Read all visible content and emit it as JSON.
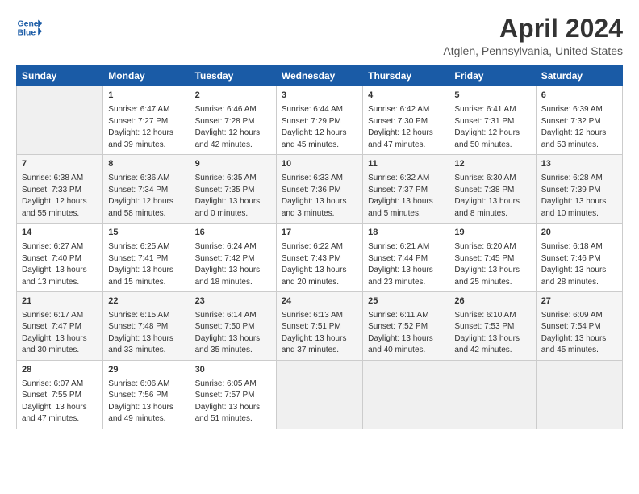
{
  "header": {
    "logo_line1": "General",
    "logo_line2": "Blue",
    "title": "April 2024",
    "subtitle": "Atglen, Pennsylvania, United States"
  },
  "columns": [
    "Sunday",
    "Monday",
    "Tuesday",
    "Wednesday",
    "Thursday",
    "Friday",
    "Saturday"
  ],
  "weeks": [
    [
      {
        "day": "",
        "content": ""
      },
      {
        "day": "1",
        "content": "Sunrise: 6:47 AM\nSunset: 7:27 PM\nDaylight: 12 hours\nand 39 minutes."
      },
      {
        "day": "2",
        "content": "Sunrise: 6:46 AM\nSunset: 7:28 PM\nDaylight: 12 hours\nand 42 minutes."
      },
      {
        "day": "3",
        "content": "Sunrise: 6:44 AM\nSunset: 7:29 PM\nDaylight: 12 hours\nand 45 minutes."
      },
      {
        "day": "4",
        "content": "Sunrise: 6:42 AM\nSunset: 7:30 PM\nDaylight: 12 hours\nand 47 minutes."
      },
      {
        "day": "5",
        "content": "Sunrise: 6:41 AM\nSunset: 7:31 PM\nDaylight: 12 hours\nand 50 minutes."
      },
      {
        "day": "6",
        "content": "Sunrise: 6:39 AM\nSunset: 7:32 PM\nDaylight: 12 hours\nand 53 minutes."
      }
    ],
    [
      {
        "day": "7",
        "content": "Sunrise: 6:38 AM\nSunset: 7:33 PM\nDaylight: 12 hours\nand 55 minutes."
      },
      {
        "day": "8",
        "content": "Sunrise: 6:36 AM\nSunset: 7:34 PM\nDaylight: 12 hours\nand 58 minutes."
      },
      {
        "day": "9",
        "content": "Sunrise: 6:35 AM\nSunset: 7:35 PM\nDaylight: 13 hours\nand 0 minutes."
      },
      {
        "day": "10",
        "content": "Sunrise: 6:33 AM\nSunset: 7:36 PM\nDaylight: 13 hours\nand 3 minutes."
      },
      {
        "day": "11",
        "content": "Sunrise: 6:32 AM\nSunset: 7:37 PM\nDaylight: 13 hours\nand 5 minutes."
      },
      {
        "day": "12",
        "content": "Sunrise: 6:30 AM\nSunset: 7:38 PM\nDaylight: 13 hours\nand 8 minutes."
      },
      {
        "day": "13",
        "content": "Sunrise: 6:28 AM\nSunset: 7:39 PM\nDaylight: 13 hours\nand 10 minutes."
      }
    ],
    [
      {
        "day": "14",
        "content": "Sunrise: 6:27 AM\nSunset: 7:40 PM\nDaylight: 13 hours\nand 13 minutes."
      },
      {
        "day": "15",
        "content": "Sunrise: 6:25 AM\nSunset: 7:41 PM\nDaylight: 13 hours\nand 15 minutes."
      },
      {
        "day": "16",
        "content": "Sunrise: 6:24 AM\nSunset: 7:42 PM\nDaylight: 13 hours\nand 18 minutes."
      },
      {
        "day": "17",
        "content": "Sunrise: 6:22 AM\nSunset: 7:43 PM\nDaylight: 13 hours\nand 20 minutes."
      },
      {
        "day": "18",
        "content": "Sunrise: 6:21 AM\nSunset: 7:44 PM\nDaylight: 13 hours\nand 23 minutes."
      },
      {
        "day": "19",
        "content": "Sunrise: 6:20 AM\nSunset: 7:45 PM\nDaylight: 13 hours\nand 25 minutes."
      },
      {
        "day": "20",
        "content": "Sunrise: 6:18 AM\nSunset: 7:46 PM\nDaylight: 13 hours\nand 28 minutes."
      }
    ],
    [
      {
        "day": "21",
        "content": "Sunrise: 6:17 AM\nSunset: 7:47 PM\nDaylight: 13 hours\nand 30 minutes."
      },
      {
        "day": "22",
        "content": "Sunrise: 6:15 AM\nSunset: 7:48 PM\nDaylight: 13 hours\nand 33 minutes."
      },
      {
        "day": "23",
        "content": "Sunrise: 6:14 AM\nSunset: 7:50 PM\nDaylight: 13 hours\nand 35 minutes."
      },
      {
        "day": "24",
        "content": "Sunrise: 6:13 AM\nSunset: 7:51 PM\nDaylight: 13 hours\nand 37 minutes."
      },
      {
        "day": "25",
        "content": "Sunrise: 6:11 AM\nSunset: 7:52 PM\nDaylight: 13 hours\nand 40 minutes."
      },
      {
        "day": "26",
        "content": "Sunrise: 6:10 AM\nSunset: 7:53 PM\nDaylight: 13 hours\nand 42 minutes."
      },
      {
        "day": "27",
        "content": "Sunrise: 6:09 AM\nSunset: 7:54 PM\nDaylight: 13 hours\nand 45 minutes."
      }
    ],
    [
      {
        "day": "28",
        "content": "Sunrise: 6:07 AM\nSunset: 7:55 PM\nDaylight: 13 hours\nand 47 minutes."
      },
      {
        "day": "29",
        "content": "Sunrise: 6:06 AM\nSunset: 7:56 PM\nDaylight: 13 hours\nand 49 minutes."
      },
      {
        "day": "30",
        "content": "Sunrise: 6:05 AM\nSunset: 7:57 PM\nDaylight: 13 hours\nand 51 minutes."
      },
      {
        "day": "",
        "content": ""
      },
      {
        "day": "",
        "content": ""
      },
      {
        "day": "",
        "content": ""
      },
      {
        "day": "",
        "content": ""
      }
    ]
  ]
}
